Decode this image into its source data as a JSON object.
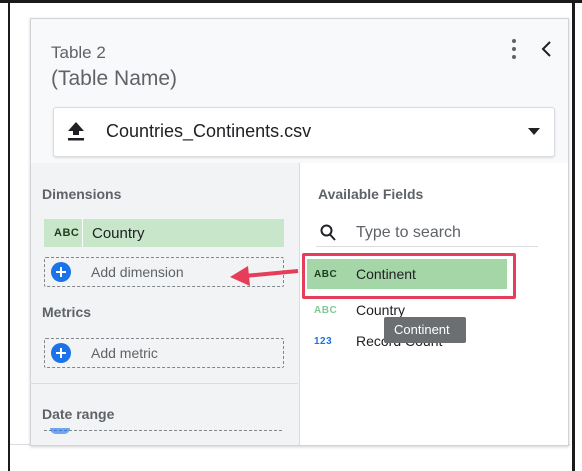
{
  "panel": {
    "title": "Table 2",
    "table_name": "(Table Name)",
    "data_source": "Countries_Continents.csv"
  },
  "dimensions": {
    "heading": "Dimensions",
    "selected": {
      "type": "ABC",
      "name": "Country"
    },
    "add_label": "Add dimension"
  },
  "metrics": {
    "heading": "Metrics",
    "add_label": "Add metric"
  },
  "date_range": {
    "heading": "Date range"
  },
  "available_fields": {
    "heading": "Available Fields",
    "search_placeholder": "Type to search",
    "items": [
      {
        "type": "ABC",
        "name": "Continent"
      },
      {
        "type": "ABC",
        "name": "Country"
      },
      {
        "type": "123",
        "name": "Record Count"
      }
    ]
  },
  "tooltip": "Continent",
  "colors": {
    "highlight_border": "#e53d5a",
    "dimension_green": "#c8e6c9",
    "accent_blue": "#1a73e8",
    "arrow_red": "#e53d5a"
  }
}
